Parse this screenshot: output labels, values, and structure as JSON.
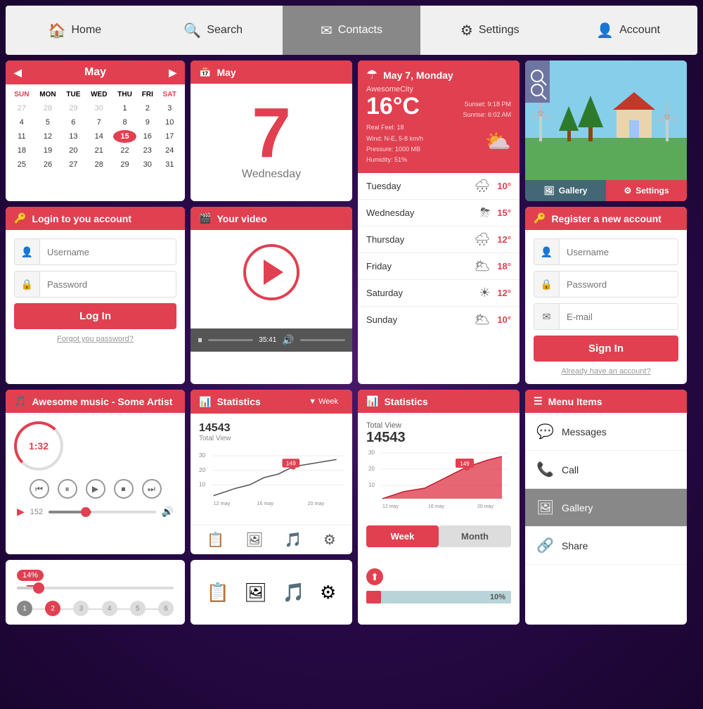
{
  "nav": {
    "items": [
      {
        "id": "home",
        "label": "Home",
        "icon": "🏠",
        "active": false
      },
      {
        "id": "search",
        "label": "Search",
        "icon": "🔍",
        "active": false
      },
      {
        "id": "contacts",
        "label": "Contacts",
        "icon": "✉",
        "active": true
      },
      {
        "id": "settings",
        "label": "Settings",
        "icon": "⚙",
        "active": false
      },
      {
        "id": "account",
        "label": "Account",
        "icon": "👤",
        "active": false
      }
    ]
  },
  "calendar": {
    "title": "May",
    "days_header": [
      "SUN",
      "MON",
      "TUE",
      "WED",
      "THU",
      "FRI",
      "SAT"
    ],
    "weeks": [
      [
        "27",
        "28",
        "29",
        "30",
        "1",
        "2",
        "3"
      ],
      [
        "4",
        "5",
        "6",
        "7",
        "8",
        "9",
        "10"
      ],
      [
        "11",
        "12",
        "13",
        "14",
        "15",
        "16",
        "17"
      ],
      [
        "18",
        "19",
        "20",
        "21",
        "22",
        "23",
        "24"
      ],
      [
        "25",
        "26",
        "27",
        "28",
        "29",
        "30",
        "31"
      ]
    ],
    "today": "15",
    "other_month": [
      "27",
      "28",
      "29",
      "30",
      "27",
      "28"
    ]
  },
  "date_widget": {
    "icon": "📅",
    "month": "May",
    "number": "7",
    "day_name": "Wednesday"
  },
  "weather": {
    "title": "May 7, Monday",
    "icon": "☂",
    "city": "AwesomeCity",
    "temp": "16°C",
    "real_feel": "Real Feel: 18",
    "wind": "Wind: N-E, 5-8 km/h",
    "pressure": "Pressure: 1000 MB",
    "humidity": "Humidity: 51%",
    "sunset": "Sunset: 9:18 PM",
    "sunrise": "Sunrise: 6:02 AM",
    "forecast": [
      {
        "day": "Tuesday",
        "icon": "🌧",
        "temp": "10°"
      },
      {
        "day": "Wednesday",
        "icon": "⛈",
        "temp": "15°"
      },
      {
        "day": "Thursday",
        "icon": "🌧",
        "temp": "12°"
      },
      {
        "day": "Friday",
        "icon": "🌥",
        "temp": "18°"
      },
      {
        "day": "Saturday",
        "icon": "☀",
        "temp": "12°"
      },
      {
        "day": "Sunday",
        "icon": "🌥",
        "temp": "10°"
      }
    ]
  },
  "scene": {
    "gallery_label": "Gallery",
    "settings_label": "Settings"
  },
  "login": {
    "title": "Login to you account",
    "icon": "🔑",
    "username_placeholder": "Username",
    "password_placeholder": "Password",
    "button_label": "Log In",
    "forgot_label": "Forgot you password?"
  },
  "video": {
    "title": "Your video",
    "icon": "🎬",
    "time": "35:41"
  },
  "register": {
    "title": "Register a new account",
    "icon": "🔑",
    "username_placeholder": "Username",
    "password_placeholder": "Password",
    "email_placeholder": "E-mail",
    "button_label": "Sign In",
    "login_label": "Already have an account?"
  },
  "music": {
    "title": "Awesome music - Some Artist",
    "icon": "🎵",
    "time": "1:32",
    "volume_pct": 40
  },
  "statistics": {
    "title": "Statistics",
    "icon": "📊",
    "week_label": "Week",
    "total_views_label": "14543",
    "total_label": "Total View",
    "peak": "149",
    "x_labels": [
      "12 may",
      "16 may",
      "20 may"
    ],
    "y_labels": [
      "30",
      "20",
      "10"
    ]
  },
  "statistics2": {
    "title": "Statistics",
    "icon": "📊",
    "total_views_label": "14543",
    "total_label": "Total View",
    "peak": "149",
    "week_tab": "Week",
    "month_tab": "Month",
    "x_labels": [
      "12 may",
      "16 may",
      "20 may"
    ]
  },
  "menu": {
    "title": "Menu Items",
    "items": [
      {
        "label": "Messages",
        "icon": "💬",
        "highlighted": false
      },
      {
        "label": "Call",
        "icon": "📞",
        "highlighted": false
      },
      {
        "label": "Gallery",
        "icon": "🖼",
        "highlighted": true
      },
      {
        "label": "Share",
        "icon": "🔗",
        "highlighted": false
      }
    ]
  },
  "slider": {
    "percent": "14%",
    "fill_pct": 14,
    "thumb_pct": 14,
    "steps": [
      {
        "label": "1",
        "state": "done"
      },
      {
        "label": "2",
        "state": "active"
      },
      {
        "label": "3",
        "state": "default"
      },
      {
        "label": "4",
        "state": "default"
      },
      {
        "label": "5",
        "state": "default"
      },
      {
        "label": "6",
        "state": "default"
      }
    ]
  },
  "icons_row": {
    "icons": [
      "📋",
      "🖼",
      "🎵",
      "⚙"
    ]
  },
  "progress": {
    "percent": "10%",
    "fill_pct": 10,
    "icon": "⬆"
  }
}
